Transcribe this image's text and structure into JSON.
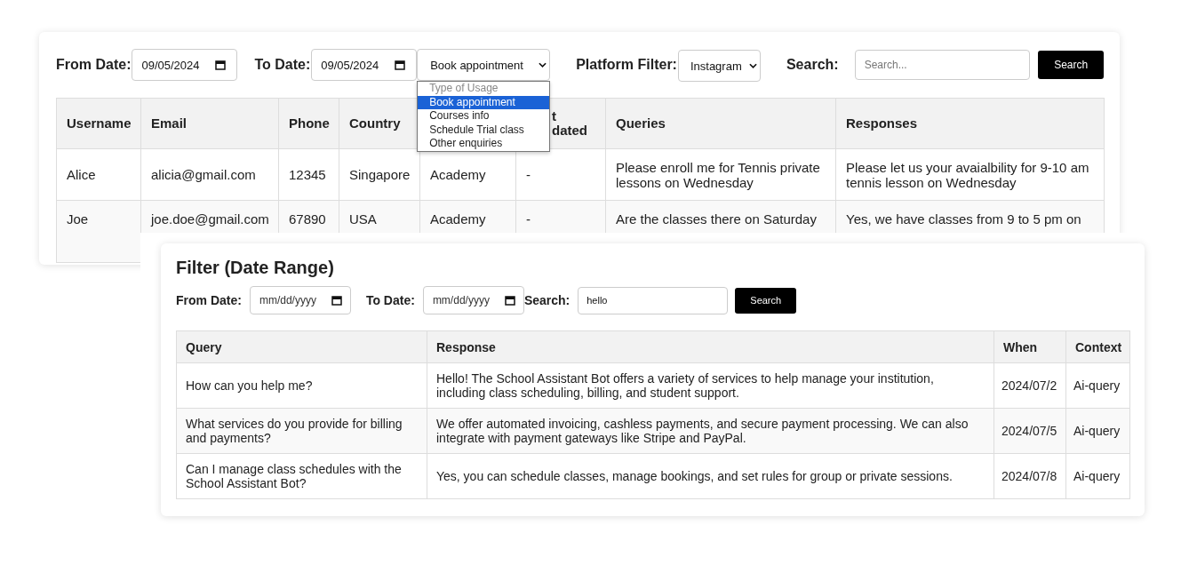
{
  "main_panel": {
    "filters": {
      "from_label": "From Date:",
      "from_value": "09/05/2024",
      "to_label": "To Date:",
      "to_value": "09/05/2024",
      "usage_select": {
        "value": "Book appointment",
        "options": [
          {
            "label": "Type of Usage",
            "kind": "placeholder",
            "selected": false
          },
          {
            "label": "Book appointment",
            "kind": "option",
            "selected": true
          },
          {
            "label": "Courses info",
            "kind": "option",
            "selected": false
          },
          {
            "label": "Schedule Trial class",
            "kind": "option",
            "selected": false
          },
          {
            "label": "Other enquiries",
            "kind": "option",
            "selected": false
          }
        ]
      },
      "platform_label": "Platform Filter:",
      "platform_value": "Instagram",
      "search_label": "Search:",
      "search_placeholder": "Search...",
      "search_button": "Search"
    },
    "table": {
      "columns": [
        "Username",
        "Email",
        "Phone",
        "Country",
        "",
        "t\ndated",
        "Queries",
        "Responses"
      ],
      "rows": [
        [
          "Alice",
          "alicia@gmail.com",
          "12345",
          "Singapore",
          "Academy",
          "-",
          "Please enroll me for Tennis private lessons on Wednesday",
          "Please let us your avaialbility for 9-10 am tennis lesson on Wednesday"
        ],
        [
          "Joe",
          "joe.doe@gmail.com",
          "67890",
          "USA",
          "Academy",
          "-",
          "Are the classes there on Saturday",
          "Yes, we have classes from 9 to 5 pm on"
        ]
      ]
    }
  },
  "filter_panel": {
    "title": "Filter (Date Range)",
    "from_label": "From Date:",
    "from_placeholder": "mm/dd/yyyy",
    "to_label": "To Date:",
    "to_placeholder": "mm/dd/yyyy",
    "search_label": "Search:",
    "search_value": "hello",
    "search_button": "Search",
    "table": {
      "columns": [
        "Query",
        "Response",
        "When",
        "Context"
      ],
      "rows": [
        [
          "How can you help me?",
          "Hello! The School Assistant Bot offers a variety of services to help manage your institution, including class scheduling, billing, and student support.",
          "2024/07/2",
          "Ai-query"
        ],
        [
          "What services do you provide for billing and payments?",
          "We offer automated invoicing, cashless payments, and secure payment processing. We can also integrate with payment gateways like Stripe and PayPal.",
          "2024/07/5",
          "Ai-query"
        ],
        [
          "Can I manage class schedules with the School Assistant Bot?",
          "Yes, you can schedule classes, manage bookings, and set rules for group or private sessions.",
          "2024/07/8",
          "Ai-query"
        ]
      ]
    }
  }
}
